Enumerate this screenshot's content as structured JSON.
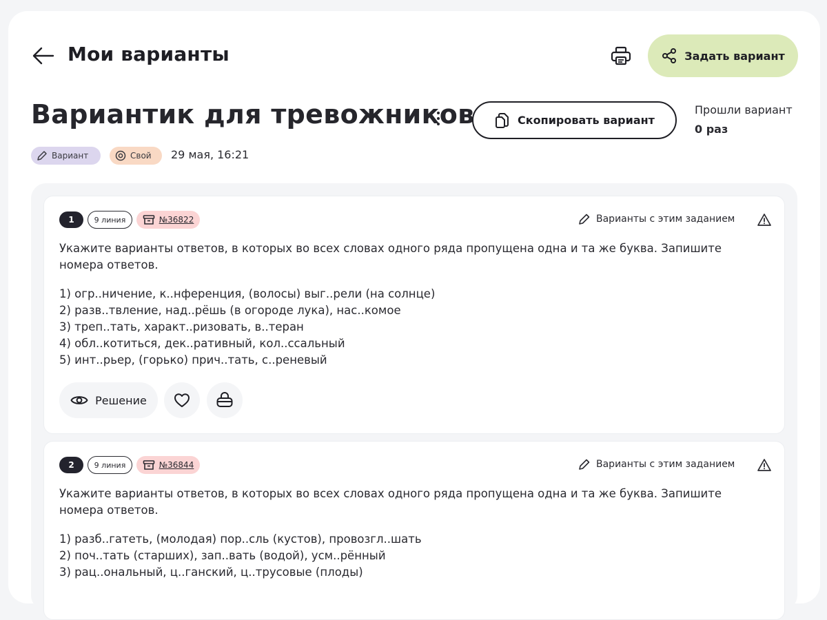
{
  "header": {
    "title": "Мои варианты",
    "assign_label": "Задать вариант"
  },
  "variant": {
    "title": "Вариантик для тревожников",
    "copy_label": "Скопировать вариант",
    "passed_label": "Прошли вариант",
    "passed_count": "0 раз",
    "tag_variant": "Вариант",
    "tag_own": "Свой",
    "date": "29 мая, 16:21"
  },
  "tasks": [
    {
      "number": "1",
      "line": "9 линия",
      "id": "№36822",
      "variants_link": "Варианты с этим заданием",
      "text": "Укажите варианты ответов, в которых во всех словах одного ряда пропущена одна и та же буква. Запишите номера ответов.",
      "options": [
        "1) огр..ничение, к..нференция, (волосы) выг..рели (на солнце)",
        "2) разв..твление, над..рёшь (в огороде лука), нас..комое",
        "3) треп..тать, характ..ризовать, в..теран",
        "4) обл..котиться, дек..ративный, кол..ссальный",
        "5) инт..рьер, (горько) прич..тать, с..реневый"
      ],
      "solution_label": "Решение"
    },
    {
      "number": "2",
      "line": "9 линия",
      "id": "№36844",
      "variants_link": "Варианты с этим заданием",
      "text": "Укажите варианты ответов, в которых во всех словах одного ряда пропущена одна и та же буква. Запишите номера ответов.",
      "options": [
        "1) разб..гатеть, (молодая) пор..сль (кустов), провозгл..шать",
        "2) поч..тать (старших), зап..вать (водой), усм..рённый",
        "3) рац..ональный, ц..ганский, ц..трусовые (плоды)"
      ]
    }
  ],
  "colors": {
    "assign_bg": "#dceab9",
    "tag_variant_bg": "#dcd6ee",
    "tag_own_bg": "#f9d9c4",
    "id_badge_bg": "#fbd4d4",
    "num_badge_bg": "#23232d"
  },
  "icons": {
    "back": "arrow-left-icon",
    "print": "printer-icon",
    "share": "share-icon",
    "more": "kebab-icon",
    "copy": "copy-icon",
    "pencil": "pencil-icon",
    "own": "at-icon",
    "archive": "archive-icon",
    "warning": "warning-icon",
    "eye": "eye-icon",
    "heart": "heart-icon",
    "basket": "basket-icon"
  }
}
